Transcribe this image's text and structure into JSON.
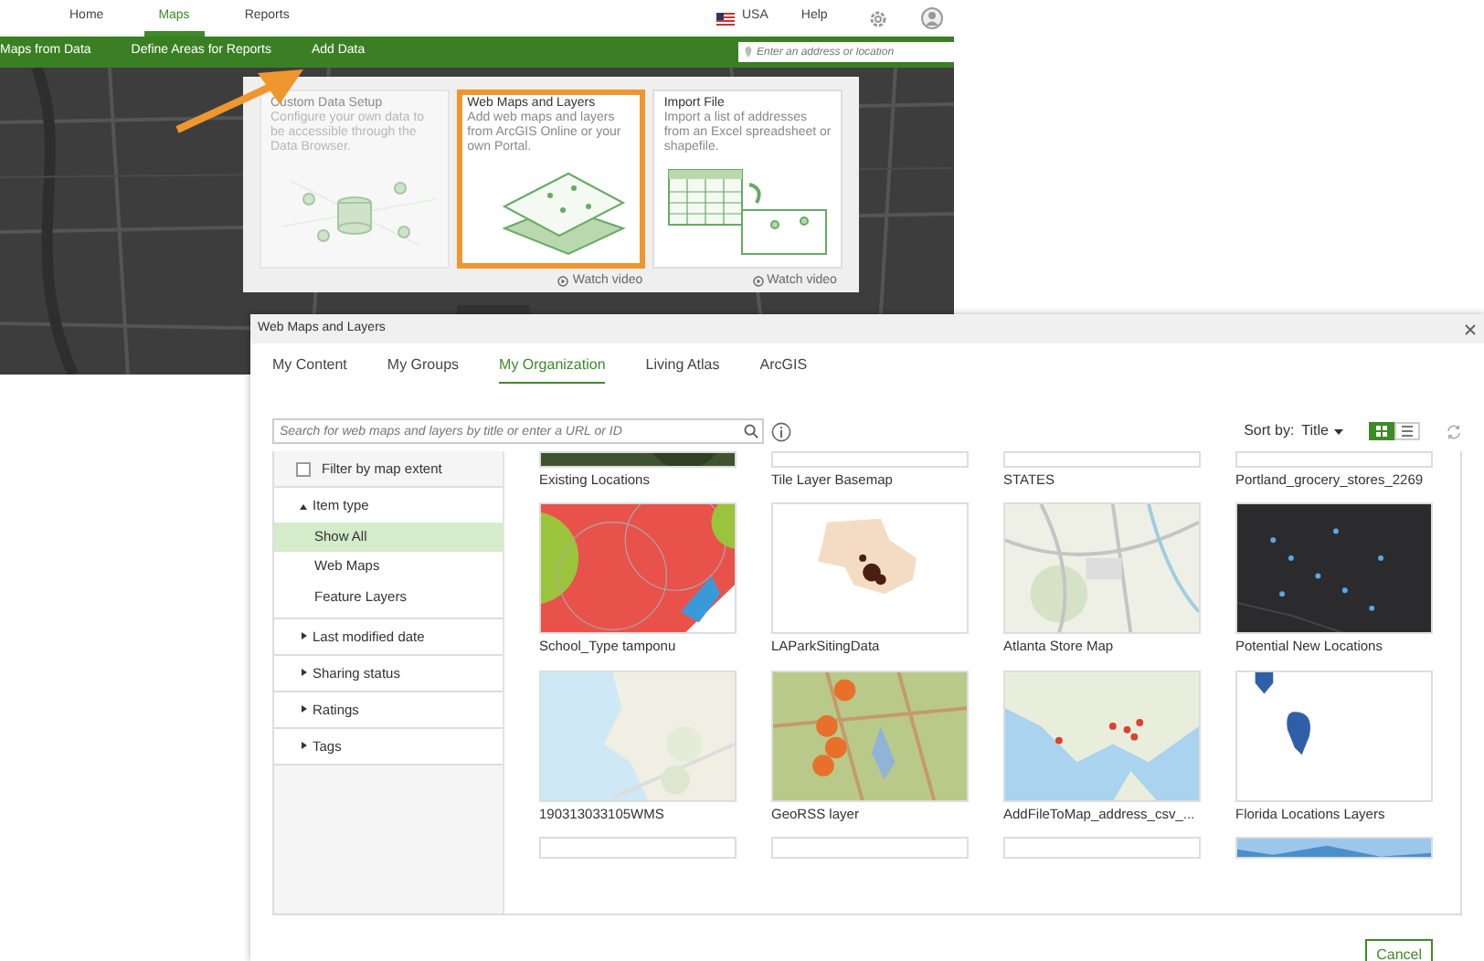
{
  "app": {
    "nav_tabs": [
      {
        "label": "Home",
        "selected": false
      },
      {
        "label": "Maps",
        "selected": true
      },
      {
        "label": "Reports",
        "selected": false
      }
    ],
    "country": "USA",
    "help": "Help",
    "subnav": [
      {
        "label": "Maps from Data"
      },
      {
        "label": "Define Areas for Reports"
      },
      {
        "label": "Add Data"
      }
    ],
    "location_search": {
      "placeholder": "Enter an address or location"
    }
  },
  "add_data_menu": {
    "options": [
      {
        "kind": "database",
        "title": "Custom Data Setup",
        "description": "Configure your own data to be accessible through the Data Browser.",
        "selected": false,
        "disabled": true
      },
      {
        "kind": "layers",
        "title": "Web Maps and Layers",
        "description": "Add web maps and layers from ArcGIS Online or your own Portal.",
        "selected": true,
        "disabled": false,
        "video_link": "Watch video"
      },
      {
        "kind": "table",
        "title": "Import File",
        "description": "Import a list of addresses from an Excel spreadsheet or shapefile.",
        "selected": false,
        "disabled": false,
        "video_link": "Watch video"
      }
    ]
  },
  "dialog": {
    "title": "Web Maps and Layers",
    "tabs": [
      {
        "label": "My Content",
        "selected": false
      },
      {
        "label": "My Groups",
        "selected": false
      },
      {
        "label": "My Organization",
        "selected": true
      },
      {
        "label": "Living Atlas",
        "selected": false
      },
      {
        "label": "ArcGIS",
        "selected": false
      }
    ],
    "search": {
      "placeholder": "Search for web maps and layers by title or enter a URL or ID"
    },
    "sort_label": "Sort by:",
    "sort_value": "Title",
    "views": [
      {
        "kind": "grid",
        "selected": true
      },
      {
        "kind": "list",
        "selected": false
      }
    ],
    "filters": [
      {
        "kind": "checkbox",
        "label": "Filter by map extent",
        "checked": false
      },
      {
        "kind": "section",
        "label": "Item type",
        "expanded": true,
        "options": [
          {
            "label": "Show All",
            "selected": true
          },
          {
            "label": "Web Maps",
            "selected": false
          },
          {
            "label": "Feature Layers",
            "selected": false
          }
        ]
      },
      {
        "kind": "section",
        "label": "Last modified date",
        "expanded": false
      },
      {
        "kind": "section",
        "label": "Sharing status",
        "expanded": false
      },
      {
        "kind": "section",
        "label": "Ratings",
        "expanded": false
      },
      {
        "kind": "section",
        "label": "Tags",
        "expanded": false
      }
    ],
    "item_rows": [
      {
        "items": [
          {
            "kind": "picture",
            "title": "Existing Locations"
          },
          {
            "kind": "blank",
            "title": "Tile Layer Basemap"
          },
          {
            "kind": "blank",
            "title": "STATES"
          },
          {
            "kind": "blank",
            "title": "Portland_grocery_stores_2269"
          }
        ]
      },
      {
        "items": [
          {
            "kind": "picture",
            "title": "School_Type tamponu"
          },
          {
            "kind": "picture",
            "title": "LAParkSitingData"
          },
          {
            "kind": "picture",
            "title": "Atlanta Store Map"
          },
          {
            "kind": "picture",
            "title": "Potential New Locations"
          }
        ]
      },
      {
        "items": [
          {
            "kind": "picture",
            "title": "190313033105WMS"
          },
          {
            "kind": "picture",
            "title": "GeoRSS layer"
          },
          {
            "kind": "picture",
            "title": "AddFileToMap_address_csv_..."
          },
          {
            "kind": "picture",
            "title": "Florida Locations Layers"
          }
        ]
      },
      {
        "items": [
          {
            "kind": "blank"
          },
          {
            "kind": "blank"
          },
          {
            "kind": "blank"
          },
          {
            "kind": "picture"
          }
        ]
      }
    ],
    "cancel": "Cancel"
  }
}
